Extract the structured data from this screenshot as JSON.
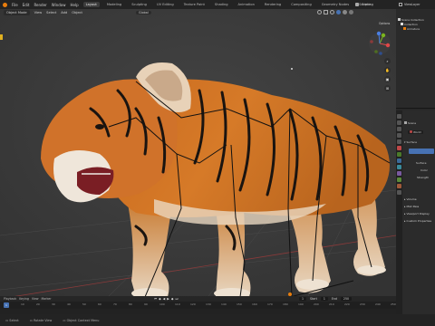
{
  "topbar": {
    "menus": [
      "File",
      "Edit",
      "Render",
      "Window",
      "Help"
    ],
    "workspaces": [
      "Layout",
      "Modeling",
      "Sculpting",
      "UV Editing",
      "Texture Paint",
      "Shading",
      "Animation",
      "Rendering",
      "Compositing",
      "Geometry Nodes",
      "Scripting"
    ],
    "active_workspace": "Layout",
    "scene_label": "Scene",
    "view_layer_label": "ViewLayer"
  },
  "viewport": {
    "header_items": [
      "Object Mode",
      "View",
      "Select",
      "Add",
      "Object"
    ],
    "transform_label": "Global",
    "options_label": "Options"
  },
  "outliner": {
    "rows": [
      "Scene Collection",
      "Collection",
      "Armature"
    ]
  },
  "properties": {
    "scene_label": "Scene",
    "world_label": "World",
    "sections": [
      "Surface",
      "Volume",
      "Mist Pass",
      "Viewport Display",
      "Custom Properties"
    ],
    "fields": [
      "Surface",
      "Color",
      "Strength"
    ]
  },
  "timeline": {
    "controls": [
      "Playback",
      "Keying",
      "View",
      "Marker"
    ],
    "current_frame": "1",
    "start_label": "Start",
    "start": "1",
    "end_label": "End",
    "end": "250",
    "ticks": [
      "0",
      "10",
      "20",
      "30",
      "40",
      "50",
      "60",
      "70",
      "80",
      "90",
      "100",
      "110",
      "120",
      "130",
      "140",
      "150",
      "160",
      "170",
      "180",
      "190",
      "200",
      "210",
      "220",
      "230",
      "240",
      "250"
    ]
  },
  "statusbar": {
    "items": [
      "Select",
      "Rotate View",
      "Object Context Menu"
    ]
  },
  "colors": {
    "viewport_bg": "#3a3a3a",
    "accent": "#4772b3",
    "axis_x": "#e04848",
    "axis_y": "#7ab51d",
    "axis_z": "#4a7ee0"
  }
}
